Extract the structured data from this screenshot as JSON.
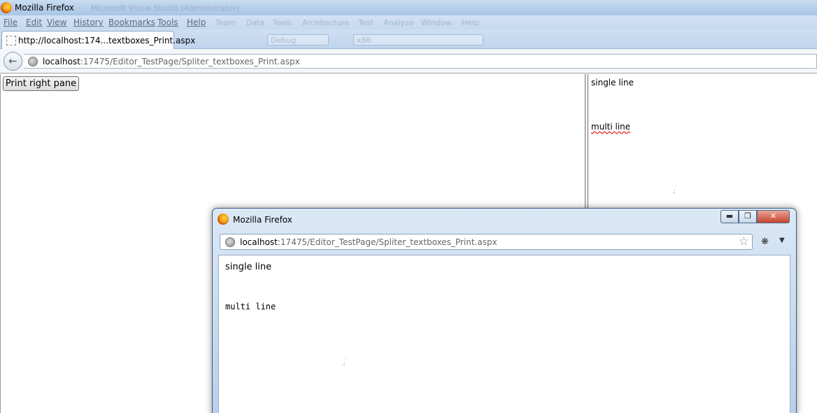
{
  "window": {
    "title": "Mozilla Firefox",
    "background_title": "Microsoft Visual Studio (Administrator)"
  },
  "menu": {
    "items": [
      "File",
      "Edit",
      "View",
      "History",
      "Bookmarks",
      "Tools",
      "Help"
    ],
    "background_items": [
      "Team",
      "Data",
      "Tools",
      "Architecture",
      "Test",
      "Analyze",
      "Window",
      "Help"
    ],
    "background_debug": "Debug",
    "background_cpu": "x86"
  },
  "tab": {
    "label": "http://localhost:174...textboxes_Print.aspx"
  },
  "address": {
    "host": "localhost",
    "path": ":17475/Editor_TestPage/Spliter_textboxes_Print.aspx"
  },
  "left_pane": {
    "print_button": "Print right pane"
  },
  "right_pane": {
    "single_line": "single line",
    "multi_line": "multi line"
  },
  "popup": {
    "title": "Mozilla Firefox",
    "url_host": "localhost",
    "url_path": ":17475/Editor_TestPage/Spliter_textboxes_Print.aspx",
    "single_line": "single line",
    "multi_line": "multi line"
  }
}
